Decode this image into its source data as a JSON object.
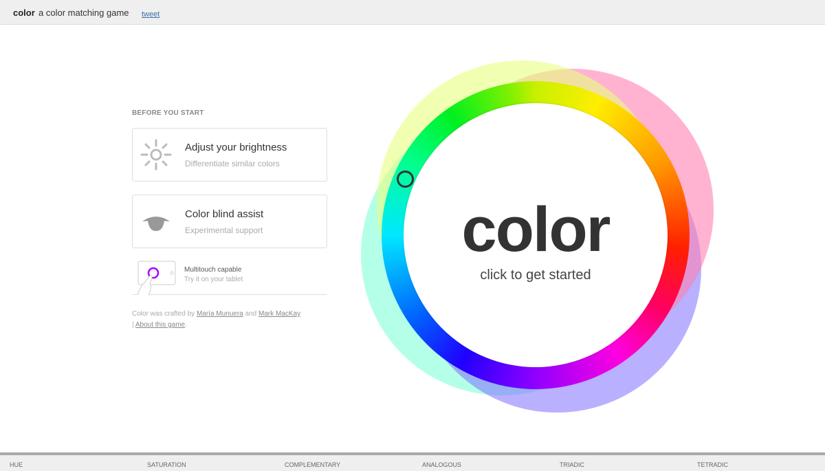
{
  "header": {
    "brand": "color",
    "tagline": "a color matching game",
    "tweet": "tweet"
  },
  "intro": {
    "heading": "BEFORE YOU START",
    "cards": [
      {
        "title": "Adjust your brightness",
        "subtitle": "Differentiate similar colors",
        "icon": "sun-icon"
      },
      {
        "title": "Color blind assist",
        "subtitle": "Experimental support",
        "icon": "eye-icon"
      }
    ],
    "multitouch": {
      "title": "Multitouch capable",
      "subtitle": "Try it on your tablet",
      "icon": "tablet-touch-icon"
    },
    "credit": {
      "prefix": "Color was crafted by",
      "author1": "María Munuera",
      "and": "and",
      "author2": "Mark MacKay",
      "sep": "|",
      "about": "About this game",
      "end": "."
    }
  },
  "wheel": {
    "title": "color",
    "subtitle": "click to get started"
  },
  "modes": [
    "HUE",
    "SATURATION",
    "COMPLEMENTARY",
    "ANALOGOUS",
    "TRIADIC",
    "TETRADIC"
  ]
}
